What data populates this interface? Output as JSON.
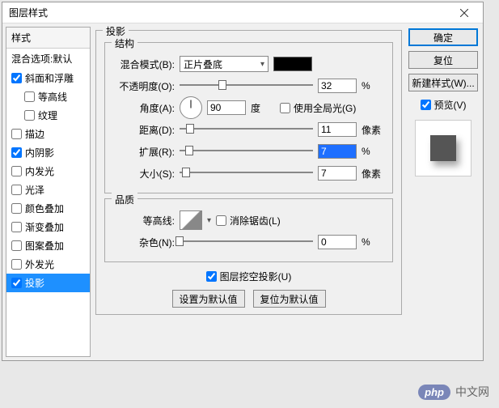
{
  "window": {
    "title": "图层样式"
  },
  "sidebar": {
    "header": "样式",
    "blend_default": "混合选项:默认",
    "items": [
      {
        "label": "斜面和浮雕",
        "checked": true,
        "indent": false
      },
      {
        "label": "等高线",
        "checked": false,
        "indent": true
      },
      {
        "label": "纹理",
        "checked": false,
        "indent": true
      },
      {
        "label": "描边",
        "checked": false,
        "indent": false
      },
      {
        "label": "内阴影",
        "checked": true,
        "indent": false
      },
      {
        "label": "内发光",
        "checked": false,
        "indent": false
      },
      {
        "label": "光泽",
        "checked": false,
        "indent": false
      },
      {
        "label": "颜色叠加",
        "checked": false,
        "indent": false
      },
      {
        "label": "渐变叠加",
        "checked": false,
        "indent": false
      },
      {
        "label": "图案叠加",
        "checked": false,
        "indent": false
      },
      {
        "label": "外发光",
        "checked": false,
        "indent": false
      },
      {
        "label": "投影",
        "checked": true,
        "indent": false,
        "selected": true
      }
    ]
  },
  "panel": {
    "title": "投影",
    "structure": {
      "legend": "结构",
      "blend_mode_label": "混合模式(B):",
      "blend_mode_value": "正片叠底",
      "opacity_label": "不透明度(O):",
      "opacity_value": "32",
      "opacity_unit": "%",
      "angle_label": "角度(A):",
      "angle_value": "90",
      "angle_unit": "度",
      "global_light_label": "使用全局光(G)",
      "global_light_checked": false,
      "distance_label": "距离(D):",
      "distance_value": "11",
      "distance_unit": "像素",
      "spread_label": "扩展(R):",
      "spread_value": "7",
      "spread_unit": "%",
      "size_label": "大小(S):",
      "size_value": "7",
      "size_unit": "像素"
    },
    "quality": {
      "legend": "品质",
      "contour_label": "等高线:",
      "antialias_label": "消除锯齿(L)",
      "antialias_checked": false,
      "noise_label": "杂色(N):",
      "noise_value": "0",
      "noise_unit": "%"
    },
    "knockout_label": "图层挖空投影(U)",
    "knockout_checked": true,
    "btn_default": "设置为默认值",
    "btn_reset": "复位为默认值"
  },
  "right": {
    "ok": "确定",
    "cancel": "复位",
    "newstyle": "新建样式(W)...",
    "preview_label": "预览(V)",
    "preview_checked": true
  },
  "watermark": {
    "logo": "php",
    "text": "中文网"
  }
}
